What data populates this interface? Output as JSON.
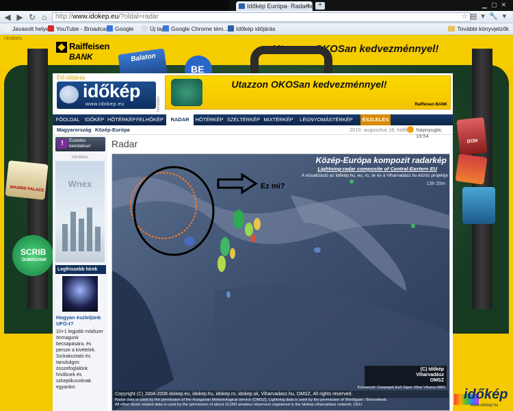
{
  "browser": {
    "tab_title": "Időkép Európa- Radarkép",
    "new_tab": "+",
    "url_host": "www.idokep.eu",
    "url_path": "/?oldal=radar",
    "url_prefix": "http://",
    "bookmarks": [
      {
        "label": "Javasolt helyek",
        "color": "#f0f0f0"
      },
      {
        "label": "YouTube - Broadcas...",
        "color": "#d12b2b"
      },
      {
        "label": "Google",
        "color": "#3a78e0"
      },
      {
        "label": "Új lap",
        "color": "#dddddd"
      },
      {
        "label": "Google Chrome tém...",
        "color": "#3a78e0"
      },
      {
        "label": "Időkép időjárás",
        "color": "#2c5fa8"
      }
    ],
    "other_bookmarks": "További könyvjelzők"
  },
  "background_ad": {
    "hirdetes": "Hirdetés",
    "bank_name_1": "Raiffeisen",
    "bank_name_2": "BANK",
    "slogan": "Utazzon OKOSan kedvezménnyel!",
    "stickers": [
      "Balaton",
      "MADRID PALACE",
      "SCRIB",
      "DUBROVNIK",
      "DON",
      "BE"
    ]
  },
  "header": {
    "elo_idojaras": "Élő időjárás",
    "logo_name": "időkép",
    "logo_url": "www.idokep.eu",
    "hirdetes": "Hirdetés",
    "banner_text": "Utazzon OKOSan kedvezménnyel!",
    "banner_brand": "Raiffeisen BANK"
  },
  "nav": [
    {
      "label": "FŐOLDAL",
      "active": false
    },
    {
      "label": "IDŐKÉP",
      "active": false
    },
    {
      "label": "HŐTÉRKÉP",
      "active": false
    },
    {
      "label": "FELHŐKÉP",
      "active": false
    },
    {
      "label": "RADAR",
      "active": true
    },
    {
      "label": "HÓTÉRKÉP",
      "active": false
    },
    {
      "label": "SZÉLTÉRKÉP",
      "active": false
    },
    {
      "label": "MIXTÉRKÉP",
      "active": false
    },
    {
      "label": "LÉGNYOMÁSTÉRKÉP",
      "active": false
    },
    {
      "label": "ÉSZLELÉS",
      "active": false
    }
  ],
  "subbar": {
    "crumb_1": "Magyarország",
    "crumb_2": "Közép-Európa",
    "date": "2010. augusztus 16. hétfő",
    "napnyugta": "Napnyugta: 19:54"
  },
  "sidebar": {
    "eszleles_button": "Észlelés beküldése!",
    "hirdetes": "Hirdetés",
    "ad_brand": "Wnex",
    "news_header": "Legfrissebb hírek",
    "news_title": "Hogyan észleljünk UFO-t?",
    "news_body": "10+1 legjobb módszer önmagunk becsapására, és persze a kivételek. Szórakoztató és tanulságos összefoglalónk hívőknek és szkeptikusoknak egyaránt."
  },
  "main": {
    "title": "Radar"
  },
  "radar": {
    "title": "Közép-Európa kompozit radarkép",
    "subtitle": "Lightning-radar composite of Central-Eastern EU",
    "note": "A vizualizáció az Időkép.hu, eu, ro, sk és a Viharvadász.hu közös projektje",
    "time": "13h 20m",
    "annotation": "Ez mi?",
    "brand_1": "(C) Időkép",
    "brand_2": "Viharvadász",
    "brand_3": "OMSZ",
    "legend": "Konvenció: Csepegek  Eső  Zápor  Vihar  Viharos  MAX",
    "copyright": "Copyright (C) 2004-2008 idokep.eu, idokep.hu, idokep.ro, idokep.sk, Viharvadasz.hu, OMSZ, All rights reserved.",
    "fineprint_1": "Radar data is used by the permission of the Hungarian Meteorological service (OMSZ). Lightning data is used by the permission of Worldgate / Boroodweb.",
    "fineprint_2": "All other storm related data is used by the permission of about 10,000 amateur observers registered in the Idokep-viharvadasz network, CEU."
  },
  "footer_logo": {
    "name": "időkép",
    "url": "www.idokep.hu"
  },
  "colors": {
    "nav_bg": "#12305e",
    "accent_yellow": "#f5c800",
    "eszleles_orange": "#d88a00",
    "link_blue": "#1a4d99"
  }
}
